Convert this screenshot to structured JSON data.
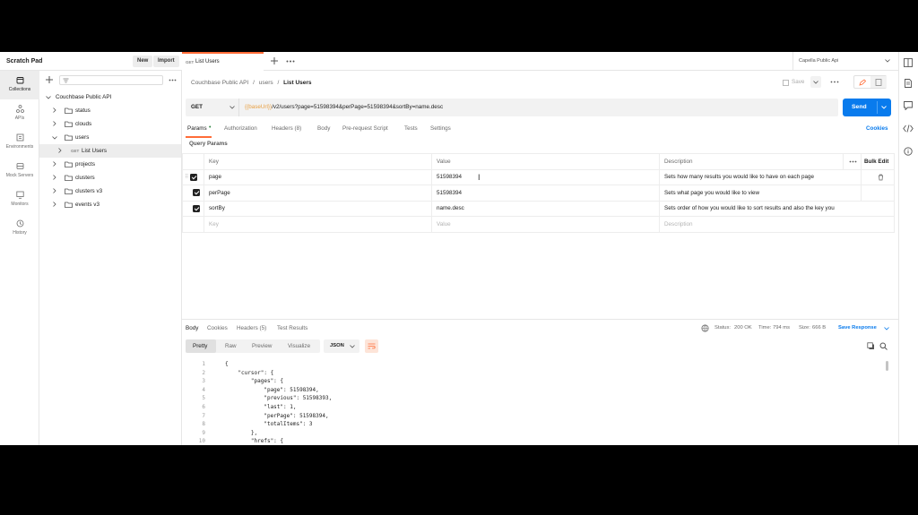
{
  "workspace": {
    "title": "Scratch Pad",
    "new_label": "New",
    "import_label": "Import"
  },
  "tab": {
    "method": "GET",
    "name": "List Users"
  },
  "environment": {
    "name": "Capella Public Api"
  },
  "leftnav": [
    {
      "label": "Collections",
      "icon": "collections-icon"
    },
    {
      "label": "APIs",
      "icon": "apis-icon"
    },
    {
      "label": "Environments",
      "icon": "environments-icon"
    },
    {
      "label": "Mock Servers",
      "icon": "mock-servers-icon"
    },
    {
      "label": "Monitors",
      "icon": "monitors-icon"
    },
    {
      "label": "History",
      "icon": "history-icon"
    }
  ],
  "collection": {
    "name": "Couchbase Public API",
    "items": [
      {
        "label": "status"
      },
      {
        "label": "clouds"
      },
      {
        "label": "users"
      },
      {
        "label": "List Users",
        "method": "GET"
      },
      {
        "label": "projects"
      },
      {
        "label": "clusters"
      },
      {
        "label": "clusters v3"
      },
      {
        "label": "events v3"
      }
    ]
  },
  "breadcrumb": {
    "root": "Couchbase Public API",
    "folder": "users",
    "current": "List Users",
    "sep": "/"
  },
  "save_label": "Save",
  "request": {
    "method": "GET",
    "url_var": "{{baseUrl}}",
    "url_rest": "/v2/users?page=51598394&perPage=51598394&sortBy=name.desc",
    "send_label": "Send"
  },
  "request_tabs": [
    "Params",
    "Authorization",
    "Headers (8)",
    "Body",
    "Pre-request Script",
    "Tests",
    "Settings"
  ],
  "cookies_label": "Cookies",
  "query_params": {
    "title": "Query Params",
    "headers": {
      "key": "Key",
      "value": "Value",
      "description": "Description",
      "bulk_edit": "Bulk Edit"
    },
    "rows": [
      {
        "key": "page",
        "value": "51598394",
        "description": "Sets how many results you would like to have on each page"
      },
      {
        "key": "perPage",
        "value": "51598394",
        "description": "Sets what page you would like to view"
      },
      {
        "key": "sortBy",
        "value": "name.desc",
        "description": "Sets order of how you would like to sort results and also the key you"
      }
    ],
    "placeholder": {
      "key": "Key",
      "value": "Value",
      "description": "Description"
    }
  },
  "response": {
    "tabs": [
      "Body",
      "Cookies",
      "Headers (5)",
      "Test Results"
    ],
    "status_label": "Status:",
    "status": "200 OK",
    "time_label": "Time:",
    "time": "794 ms",
    "size_label": "Size:",
    "size": "666 B",
    "save_response": "Save Response",
    "formats": [
      "Pretty",
      "Raw",
      "Preview",
      "Visualize"
    ],
    "language": "JSON",
    "lines": [
      {
        "n": "1",
        "t": "{"
      },
      {
        "n": "2",
        "t": "    \"cursor\": {"
      },
      {
        "n": "3",
        "t": "        \"pages\": {"
      },
      {
        "n": "4",
        "t": "            \"page\": 51598394,"
      },
      {
        "n": "5",
        "t": "            \"previous\": 51598393,"
      },
      {
        "n": "6",
        "t": "            \"last\": 1,"
      },
      {
        "n": "7",
        "t": "            \"perPage\": 51598394,"
      },
      {
        "n": "8",
        "t": "            \"totalItems\": 3"
      },
      {
        "n": "9",
        "t": "        },"
      },
      {
        "n": "10",
        "t": "        \"hrefs\": {"
      }
    ]
  },
  "colors": {
    "accent": "#ff6c37",
    "send": "#097bed",
    "status_ok": "#2e8540"
  }
}
